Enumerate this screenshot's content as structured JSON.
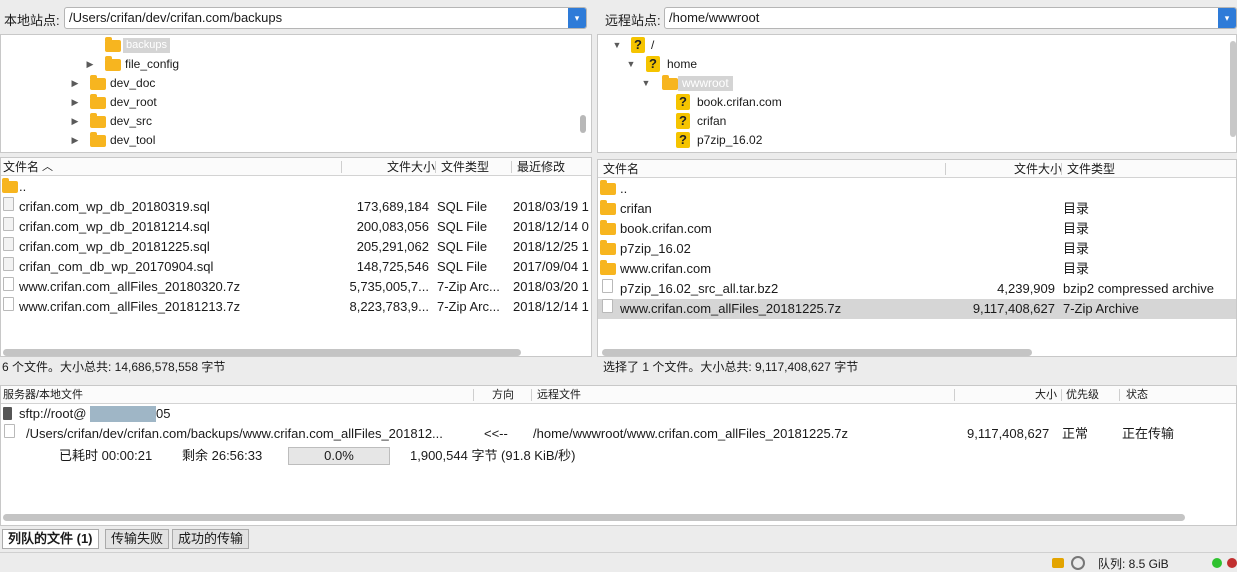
{
  "local": {
    "site_label": "本地站点:",
    "path": "/Users/crifan/dev/crifan.com/backups",
    "tree": [
      {
        "name": "backups",
        "selected": true,
        "expanded": false
      },
      {
        "name": "file_config"
      },
      {
        "name": "dev_doc"
      },
      {
        "name": "dev_root"
      },
      {
        "name": "dev_src"
      },
      {
        "name": "dev_tool"
      }
    ],
    "columns": {
      "name": "文件名",
      "size": "文件大小",
      "type": "文件类型",
      "modified": "最近修改"
    },
    "files": [
      {
        "name": "..",
        "size": "",
        "type": "",
        "modified": ""
      },
      {
        "name": "crifan.com_wp_db_20180319.sql",
        "size": "173,689,184",
        "type": "SQL File",
        "modified": "2018/03/19 1"
      },
      {
        "name": "crifan.com_wp_db_20181214.sql",
        "size": "200,083,056",
        "type": "SQL File",
        "modified": "2018/12/14 0"
      },
      {
        "name": "crifan.com_wp_db_20181225.sql",
        "size": "205,291,062",
        "type": "SQL File",
        "modified": "2018/12/25 1"
      },
      {
        "name": "crifan_com_db_wp_20170904.sql",
        "size": "148,725,546",
        "type": "SQL File",
        "modified": "2017/09/04 1"
      },
      {
        "name": "www.crifan.com_allFiles_20180320.7z",
        "size": "5,735,005,7...",
        "type": "7-Zip Arc...",
        "modified": "2018/03/20 1"
      },
      {
        "name": "www.crifan.com_allFiles_20181213.7z",
        "size": "8,223,783,9...",
        "type": "7-Zip Arc...",
        "modified": "2018/12/14 1"
      }
    ],
    "status": "6 个文件。大小总共: 14,686,578,558 字节"
  },
  "remote": {
    "site_label": "远程站点:",
    "path": "/home/wwwroot",
    "tree": [
      {
        "name": "/"
      },
      {
        "name": "home"
      },
      {
        "name": "wwwroot",
        "selected": true
      },
      {
        "name": "book.crifan.com"
      },
      {
        "name": "crifan"
      },
      {
        "name": "p7zip_16.02"
      }
    ],
    "columns": {
      "name": "文件名",
      "size": "文件大小",
      "type": "文件类型"
    },
    "files": [
      {
        "name": "..",
        "size": "",
        "type": ""
      },
      {
        "name": "crifan",
        "size": "",
        "type": "目录"
      },
      {
        "name": "book.crifan.com",
        "size": "",
        "type": "目录"
      },
      {
        "name": "p7zip_16.02",
        "size": "",
        "type": "目录"
      },
      {
        "name": "www.crifan.com",
        "size": "",
        "type": "目录"
      },
      {
        "name": "p7zip_16.02_src_all.tar.bz2",
        "size": "4,239,909",
        "type": "bzip2 compressed archive"
      },
      {
        "name": "www.crifan.com_allFiles_20181225.7z",
        "size": "9,117,408,627",
        "type": "7-Zip Archive",
        "selected": true
      }
    ],
    "status": "选择了 1 个文件。大小总共: 9,117,408,627 字节"
  },
  "queue": {
    "columns": {
      "server": "服务器/本地文件",
      "direction": "方向",
      "remote": "远程文件",
      "size": "大小",
      "priority": "优先级",
      "status": "状态"
    },
    "server": "sftp://root@",
    "server_suffix": "05",
    "transfer": {
      "local": "/Users/crifan/dev/crifan.com/backups/www.crifan.com_allFiles_201812...",
      "direction": "<<--",
      "remote": "/home/wwwroot/www.crifan.com_allFiles_20181225.7z",
      "size": "9,117,408,627",
      "priority": "正常",
      "status": "正在传输"
    },
    "elapsed": "已耗时 00:00:21",
    "remaining": "剩余 26:56:33",
    "progress_text": "0.0%",
    "progress": 0.0,
    "speed": "1,900,544 字节 (91.8 KiB/秒)"
  },
  "tabs": [
    "列队的文件 (1)",
    "传输失败",
    "成功的传输"
  ],
  "statusbar": {
    "queue": "队列: 8.5 GiB"
  }
}
